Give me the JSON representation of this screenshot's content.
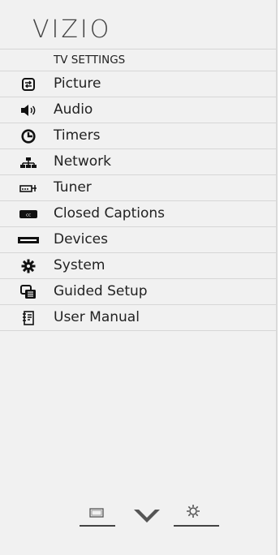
{
  "header": {
    "brand": "VIZIO"
  },
  "menu": {
    "title": "TV SETTINGS",
    "items": [
      {
        "label": "Picture",
        "icon": "picture-icon"
      },
      {
        "label": "Audio",
        "icon": "speaker-icon"
      },
      {
        "label": "Timers",
        "icon": "clock-icon"
      },
      {
        "label": "Network",
        "icon": "network-icon"
      },
      {
        "label": "Tuner",
        "icon": "tuner-icon"
      },
      {
        "label": "Closed Captions",
        "icon": "cc-icon"
      },
      {
        "label": "Devices",
        "icon": "devices-icon"
      },
      {
        "label": "System",
        "icon": "gear-icon"
      },
      {
        "label": "Guided Setup",
        "icon": "guided-setup-icon"
      },
      {
        "label": "User Manual",
        "icon": "manual-icon"
      }
    ]
  },
  "bottom_bar": {
    "buttons": [
      "input-icon",
      "chevron-down-icon",
      "settings-icon"
    ]
  }
}
